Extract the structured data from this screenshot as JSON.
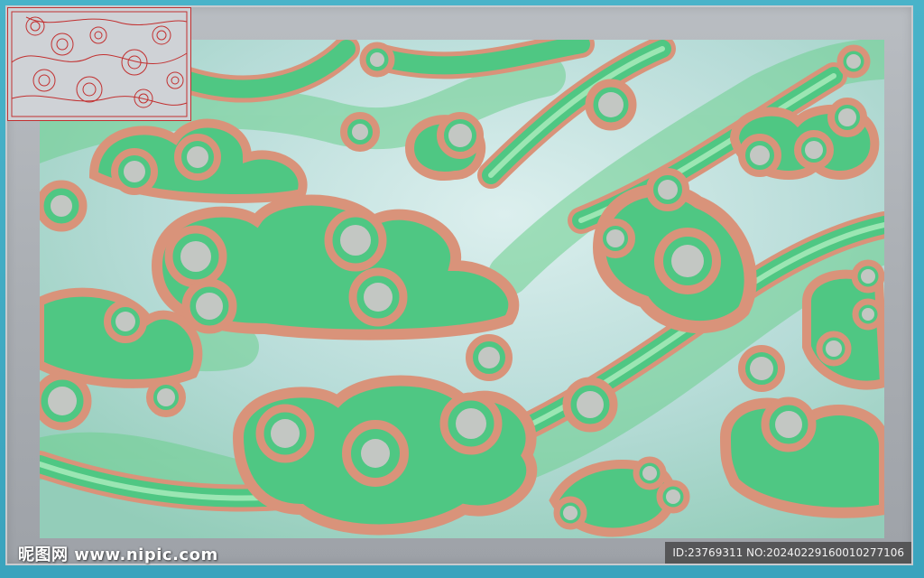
{
  "image": {
    "subject": "carved auspicious cloud relief panel",
    "colors": {
      "background_outer": "#3fa9c2",
      "frame": "#b2b6bb",
      "panel_sky": "#b9dde0",
      "cloud_green": "#4fc783",
      "cloud_edge": "#d9937a",
      "cloud_hole": "#c3c7c3",
      "thumbnail_lines": "#c23030"
    }
  },
  "watermark": {
    "logo_text": "昵图网",
    "site": "www.nipic.com"
  },
  "id_badge": {
    "text": "ID:23769311 NO:20240229160010277106"
  }
}
